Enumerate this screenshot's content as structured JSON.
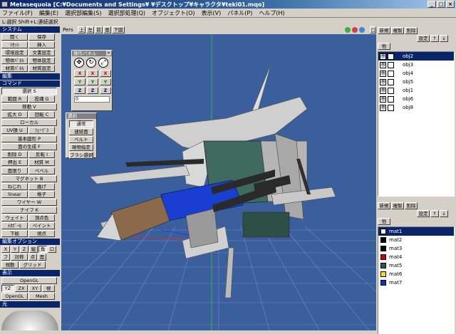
{
  "window": {
    "title": "Metasequoia [C:¥Documents and Settings¥        ¥デスクトップ¥キャラクタ¥teki01.mqo]",
    "buttons": [
      "_",
      "□",
      "×"
    ]
  },
  "menu": [
    "ファイル(F)",
    "編集(E)",
    "選択部編集(S)",
    "選択部処理(Q)",
    "オブジェクト(O)",
    "表示(V)",
    "パネル(P)",
    "ヘルプ(H)"
  ],
  "status": "L:選択  Shift+L:連続選択",
  "left": {
    "system_head": "システム",
    "system_buttons": [
      "開く",
      "保存",
      "ﾘｾｯﾄ",
      "挿入",
      "環境設定",
      "文書設定",
      "物体ﾊﾟﾈﾙ",
      "物体設定",
      "材質ﾊﾟﾈﾙ",
      "材質設定"
    ],
    "edit_head": "編集",
    "command_head": "コマンド",
    "command_buttons": [
      "選択 S",
      "範囲 R",
      "投縄 G",
      "移動 V",
      "拡大 D",
      "回転 C",
      "ローカル",
      "UV操 U",
      "ﾌｪｰﾌﾞﾗ",
      "基本図形 P",
      "面の生成 F",
      "削除 D",
      "反転 I",
      "押出 E",
      "材質 M",
      "面張り",
      "ベベル",
      "マグネット B",
      "ねじれ",
      "曲げ",
      "linear",
      "格子",
      "ワイヤー W",
      "ナイフ K",
      "ウェイト",
      "頂点色",
      "ﾒﾀﾎﾞｰﾙ",
      "ペイント",
      "下絵",
      "視点"
    ],
    "edit_option_head": "編集オプション",
    "edit_option_buttons": [
      "X",
      "Y",
      "Z",
      "縦",
      "角",
      "ロ",
      "フ",
      "対称",
      "点",
      "面",
      "視動",
      "グリッド"
    ],
    "display_head": "表示",
    "display_buttons": [
      "OpenGL",
      "YZ",
      "ZX",
      "XY",
      "視",
      "OpenGL",
      "Mesh"
    ],
    "light_head": "光"
  },
  "viewport": {
    "view_label": "Pers",
    "tab_buttons": [
      "上",
      "左",
      "前",
      "画",
      "下図"
    ],
    "bg_color": "#3b5f9c"
  },
  "coord_palette": {
    "title": "操作パネル",
    "icons": [
      "move-icon",
      "rotate-icon",
      "scale-icon"
    ],
    "axes": [
      "X",
      "X",
      "X",
      "Y",
      "Y",
      "Y",
      "Z",
      "Z",
      "Z"
    ],
    "value": "0"
  },
  "select_palette": {
    "title": "選択",
    "buttons": [
      "通常",
      "連続面",
      "ベルト",
      "現物指定",
      "ブラシ選択"
    ]
  },
  "objects_panel": {
    "buttons": [
      "新規",
      "複製",
      "削除",
      "設定",
      "↑",
      "↓",
      "他"
    ],
    "items": [
      "obj2",
      "obj3",
      "obj4",
      "obj5",
      "obj1",
      "obj6",
      "obj8"
    ],
    "selected": "obj2"
  },
  "materials_panel": {
    "buttons": [
      "新規",
      "複製",
      "削除",
      "設定",
      "↑",
      "↓",
      "他"
    ],
    "items": [
      {
        "name": "mat1",
        "color": "#ffffff"
      },
      {
        "name": "mat2",
        "color": "#000000"
      },
      {
        "name": "mat3",
        "color": "#000000"
      },
      {
        "name": "mat4",
        "color": "#cc0000"
      },
      {
        "name": "mat5",
        "color": "#2e5a4a"
      },
      {
        "name": "mat6",
        "color": "#f0e000"
      },
      {
        "name": "mat7",
        "color": "#1030c0"
      }
    ],
    "selected": "mat1"
  }
}
